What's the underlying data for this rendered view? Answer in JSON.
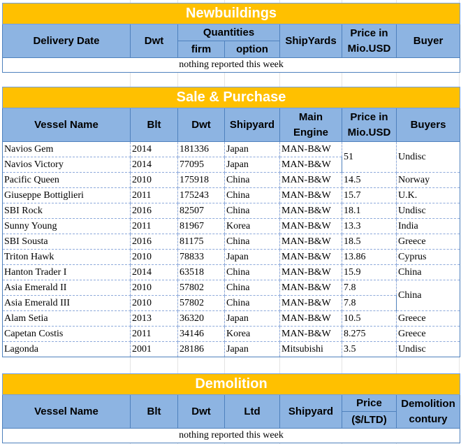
{
  "newbuildings": {
    "title": "Newbuildings",
    "headers": {
      "delivery_date": "Delivery Date",
      "dwt": "Dwt",
      "quantities": "Quantities",
      "firm": "firm",
      "option": "option",
      "shipyards": "ShipYards",
      "price": "Price in Mio.USD",
      "buyer": "Buyer"
    },
    "note": "nothing reported this week"
  },
  "sale_purchase": {
    "title": "Sale & Purchase",
    "headers": {
      "vessel_name": "Vessel Name",
      "blt": "Blt",
      "dwt": "Dwt",
      "shipyard": "Shipyard",
      "main_engine": "Main Engine",
      "price": "Price in Mio.USD",
      "buyers": "Buyers"
    },
    "rows": [
      {
        "vessel": "Navios Gem",
        "blt": "2014",
        "dwt": "181336",
        "shipyard": "Japan",
        "engine": "MAN-B&W",
        "price": "51",
        "buyers": "Undisc"
      },
      {
        "vessel": "Navios Victory",
        "blt": "2014",
        "dwt": "77095",
        "shipyard": "Japan",
        "engine": "MAN-B&W",
        "price": "",
        "buyers": ""
      },
      {
        "vessel": "Pacific Queen",
        "blt": "2010",
        "dwt": "175918",
        "shipyard": "China",
        "engine": "MAN-B&W",
        "price": "14.5",
        "buyers": "Norway"
      },
      {
        "vessel": "Giuseppe Bottiglieri",
        "blt": "2011",
        "dwt": "175243",
        "shipyard": "China",
        "engine": "MAN-B&W",
        "price": "15.7",
        "buyers": "U.K."
      },
      {
        "vessel": "SBI Rock",
        "blt": "2016",
        "dwt": "82507",
        "shipyard": "China",
        "engine": "MAN-B&W",
        "price": "18.1",
        "buyers": "Undisc"
      },
      {
        "vessel": "Sunny Young",
        "blt": "2011",
        "dwt": "81967",
        "shipyard": "Korea",
        "engine": "MAN-B&W",
        "price": "13.3",
        "buyers": "India"
      },
      {
        "vessel": "SBI Sousta",
        "blt": "2016",
        "dwt": "81175",
        "shipyard": "China",
        "engine": "MAN-B&W",
        "price": "18.5",
        "buyers": "Greece"
      },
      {
        "vessel": "Triton Hawk",
        "blt": "2010",
        "dwt": "78833",
        "shipyard": "Japan",
        "engine": "MAN-B&W",
        "price": "13.86",
        "buyers": "Cyprus"
      },
      {
        "vessel": "Hanton Trader I",
        "blt": "2014",
        "dwt": "63518",
        "shipyard": "China",
        "engine": "MAN-B&W",
        "price": "15.9",
        "buyers": "China"
      },
      {
        "vessel": "Asia Emerald II",
        "blt": "2010",
        "dwt": "57802",
        "shipyard": "China",
        "engine": "MAN-B&W",
        "price": "7.8",
        "buyers": "China"
      },
      {
        "vessel": "Asia Emerald III",
        "blt": "2010",
        "dwt": "57802",
        "shipyard": "China",
        "engine": "MAN-B&W",
        "price": "7.8",
        "buyers": ""
      },
      {
        "vessel": "Alam Setia",
        "blt": "2013",
        "dwt": "36320",
        "shipyard": "Japan",
        "engine": "MAN-B&W",
        "price": "10.5",
        "buyers": "Greece"
      },
      {
        "vessel": "Capetan Costis",
        "blt": "2011",
        "dwt": "34146",
        "shipyard": "Korea",
        "engine": "MAN-B&W",
        "price": "8.275",
        "buyers": "Greece"
      },
      {
        "vessel": "Lagonda",
        "blt": "2001",
        "dwt": "28186",
        "shipyard": "Japan",
        "engine": "Mitsubishi",
        "price": "3.5",
        "buyers": "Undisc"
      }
    ]
  },
  "demolition": {
    "title": "Demolition",
    "headers": {
      "vessel_name": "Vessel Name",
      "blt": "Blt",
      "dwt": "Dwt",
      "ltd": "Ltd",
      "shipyard": "Shipyard",
      "price": "Price",
      "price_unit": "($/LTD)",
      "demolition_country": "Demolition contury"
    },
    "note": "nothing reported this week"
  }
}
